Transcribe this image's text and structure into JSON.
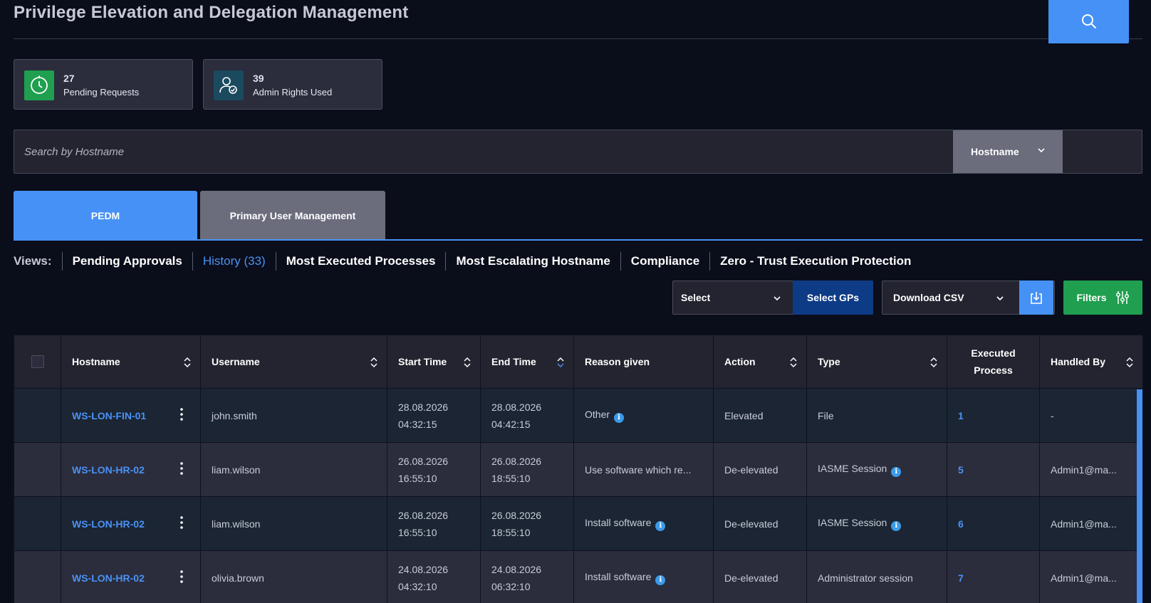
{
  "page": {
    "title": "Privilege Elevation and Delegation Management"
  },
  "stats": [
    {
      "value": "27",
      "label": "Pending Requests",
      "icon": "timer-icon",
      "color": "#1f9f4f"
    },
    {
      "value": "39",
      "label": "Admin Rights Used",
      "icon": "user-shield-icon",
      "color": "#1b4a5e"
    }
  ],
  "search": {
    "placeholder": "Search by Hostname",
    "field": "Hostname"
  },
  "tabs": [
    {
      "label": "PEDM",
      "active": true
    },
    {
      "label": "Primary User Management",
      "active": false
    }
  ],
  "views": {
    "label": "Views:",
    "items": [
      {
        "label": "Pending Approvals",
        "active": false
      },
      {
        "label": "History (33)",
        "active": true
      },
      {
        "label": "Most Executed Processes",
        "active": false
      },
      {
        "label": "Most Escalating Hostname",
        "active": false
      },
      {
        "label": "Compliance",
        "active": false
      },
      {
        "label": "Zero - Trust Execution Protection",
        "active": false
      }
    ]
  },
  "toolbar": {
    "select_label": "Select",
    "select_gps_label": "Select GPs",
    "download_label": "Download CSV",
    "filters_label": "Filters"
  },
  "table": {
    "headers": {
      "hostname": "Hostname",
      "username": "Username",
      "start_time": "Start Time",
      "end_time": "End Time",
      "reason": "Reason given",
      "action": "Action",
      "type": "Type",
      "executed_1": "Executed",
      "executed_2": "Process",
      "handled_by": "Handled By"
    },
    "rows": [
      {
        "hostname": "WS-LON-FIN-01",
        "username": "john.smith",
        "start_date": "28.08.2026",
        "start_time": "04:32:15",
        "end_date": "28.08.2026",
        "end_time": "04:42:15",
        "reason": "Other",
        "action": "Elevated",
        "type": "File",
        "executed": "1",
        "handled_by": "-"
      },
      {
        "hostname": "WS-LON-HR-02",
        "username": "liam.wilson",
        "start_date": "26.08.2026",
        "start_time": "16:55:10",
        "end_date": "26.08.2026",
        "end_time": "18:55:10",
        "reason": "Use software which re...",
        "action": "De-elevated",
        "type": "IASME Session",
        "executed": "5",
        "handled_by": "Admin1@ma..."
      },
      {
        "hostname": "WS-LON-HR-02",
        "username": "liam.wilson",
        "start_date": "26.08.2026",
        "start_time": "16:55:10",
        "end_date": "26.08.2026",
        "end_time": "18:55:10",
        "reason": "Install software",
        "action": "De-elevated",
        "type": "IASME Session",
        "executed": "6",
        "handled_by": "Admin1@ma..."
      },
      {
        "hostname": "WS-LON-HR-02",
        "username": "olivia.brown",
        "start_date": "24.08.2026",
        "start_time": "04:32:10",
        "end_date": "24.08.2026",
        "end_time": "06:32:10",
        "reason": "Install software",
        "action": "De-elevated",
        "type": "Administrator session",
        "executed": "7",
        "handled_by": "Admin1@ma..."
      }
    ]
  }
}
